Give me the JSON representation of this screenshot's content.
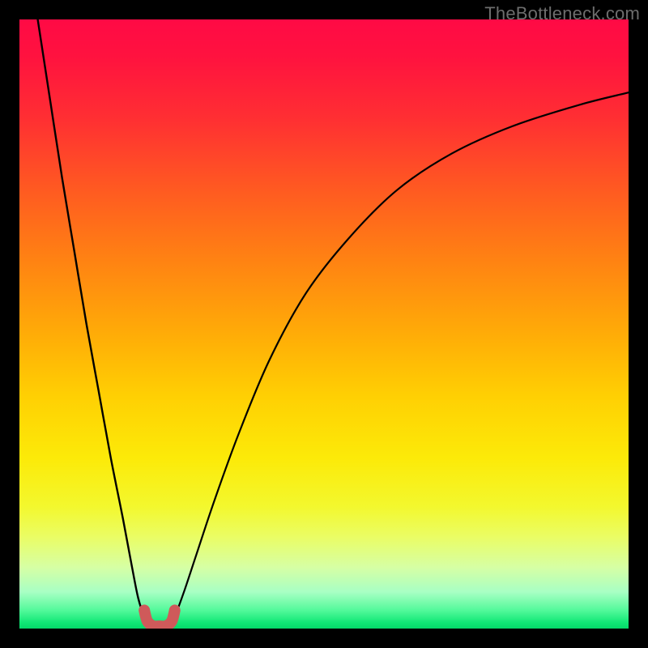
{
  "watermark": "TheBottleneck.com",
  "chart_data": {
    "type": "line",
    "title": "",
    "xlabel": "",
    "ylabel": "",
    "xlim": [
      0,
      100
    ],
    "ylim": [
      0,
      100
    ],
    "grid": false,
    "series": [
      {
        "name": "curve-left",
        "x": [
          3,
          5,
          7,
          9,
          11,
          13,
          15,
          17,
          18.5,
          19.5,
          20.5,
          21.5
        ],
        "values": [
          100,
          87,
          74,
          62,
          50,
          39,
          28,
          18,
          10,
          5,
          2,
          0.5
        ]
      },
      {
        "name": "curve-right",
        "x": [
          24.5,
          25.5,
          27,
          29,
          32,
          36,
          41,
          47,
          54,
          62,
          71,
          81,
          92,
          100
        ],
        "values": [
          0.5,
          2,
          6,
          12,
          21,
          32,
          44,
          55,
          64,
          72,
          78,
          82.5,
          86,
          88
        ]
      },
      {
        "name": "base-marker",
        "x": [
          20.5,
          21,
          22,
          23,
          24,
          25,
          25.5
        ],
        "values": [
          3,
          1.2,
          0.4,
          0.4,
          0.4,
          1.2,
          3
        ]
      }
    ],
    "colors": {
      "curve": "#000000",
      "marker": "#cf5a5a",
      "gradient_top": "#ff0a45",
      "gradient_bottom": "#04da69"
    },
    "annotations": [
      {
        "text": "TheBottleneck.com",
        "position": "top-right"
      }
    ]
  }
}
